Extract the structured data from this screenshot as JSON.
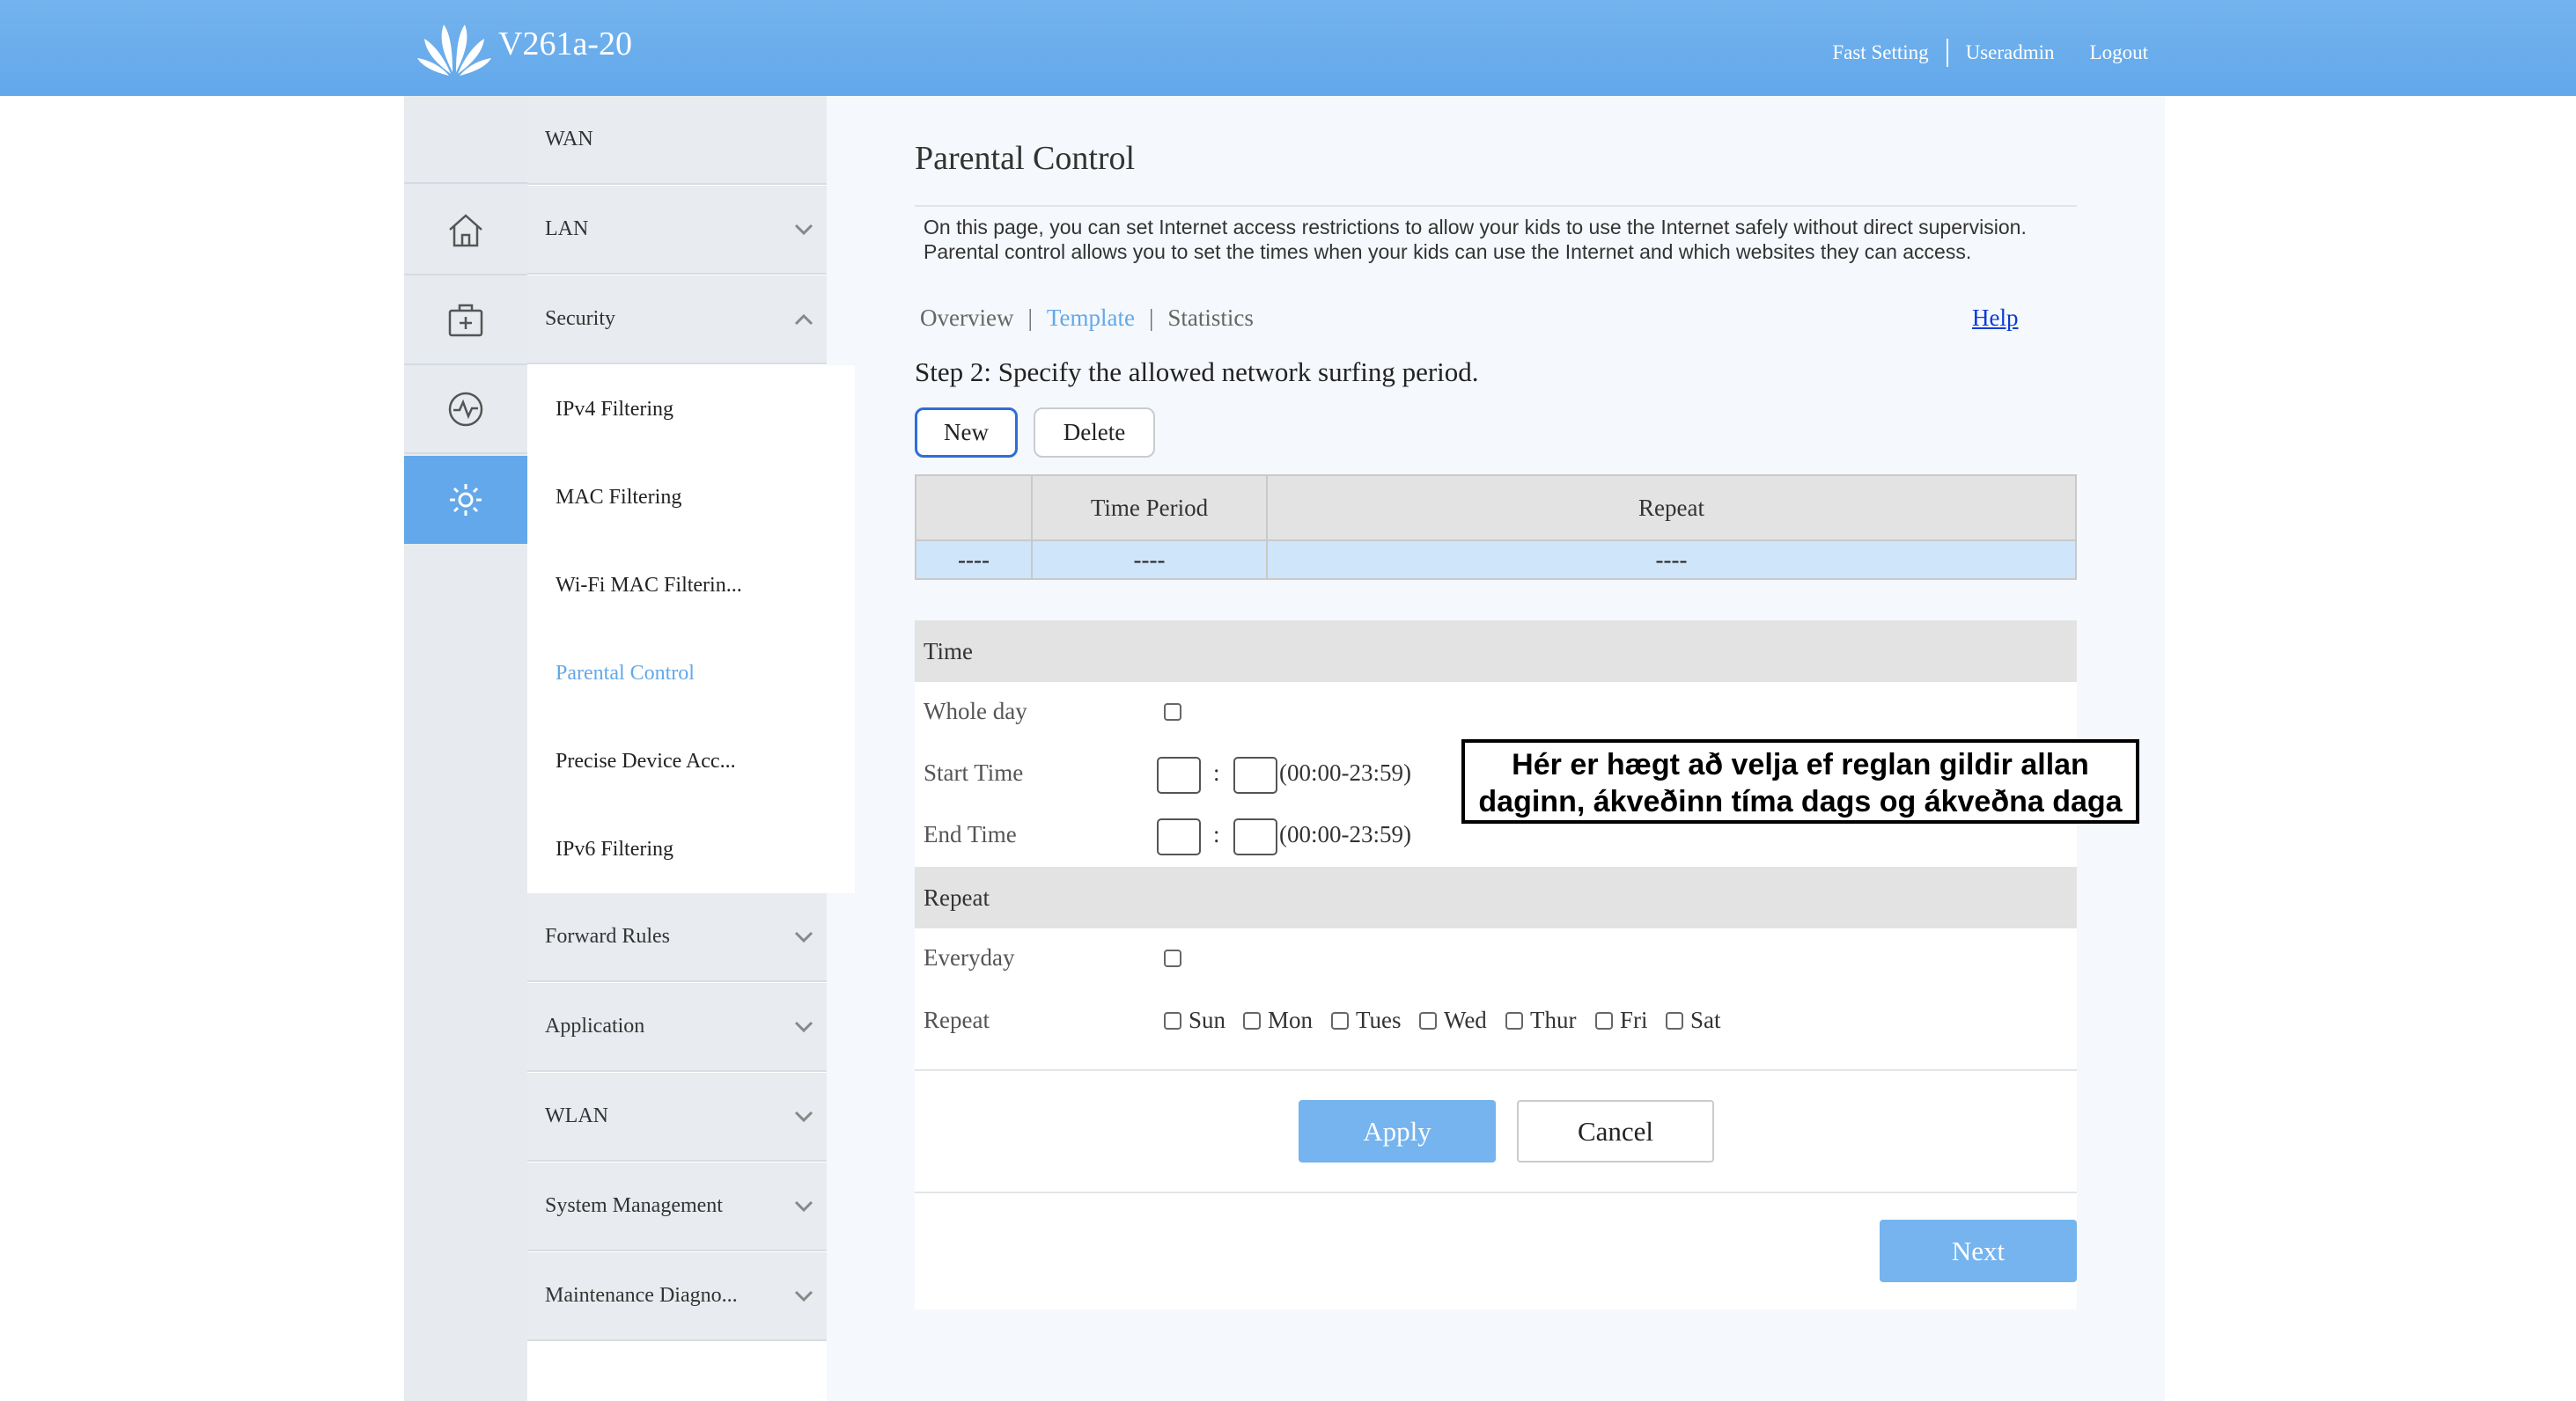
{
  "header": {
    "model": "V261a-20",
    "links": [
      "Fast Setting",
      "Useradmin",
      "Logout"
    ]
  },
  "icons": [
    "home-icon",
    "first-aid-icon",
    "diagnostics-icon",
    "settings-icon"
  ],
  "menu": {
    "wan": "WAN",
    "lan": "LAN",
    "security": "Security",
    "security_sub": [
      "IPv4 Filtering",
      "MAC Filtering",
      "Wi-Fi MAC Filterin...",
      "Parental Control",
      "Precise Device Acc...",
      "IPv6 Filtering"
    ],
    "forward_rules": "Forward Rules",
    "application": "Application",
    "wlan": "WLAN",
    "system_management": "System Management",
    "maintenance": "Maintenance Diagno..."
  },
  "main": {
    "title": "Parental Control",
    "intro_line1": "On this page, you can set Internet access restrictions to allow your kids to use the Internet safely without direct supervision.",
    "intro_line2": "Parental control allows you to set the times when your kids can use the Internet and which websites they can access.",
    "tabs": [
      "Overview",
      "Template",
      "Statistics"
    ],
    "tab_sep": "|",
    "help": "Help",
    "step": "Step 2: Specify the allowed network surfing period.",
    "buttons": {
      "new": "New",
      "delete": "Delete"
    },
    "table": {
      "headers": [
        "",
        "Time Period",
        "Repeat"
      ],
      "row": [
        "----",
        "----",
        "----"
      ]
    },
    "form": {
      "time_header": "Time",
      "whole_day": "Whole day",
      "start_time": "Start Time",
      "end_time": "End Time",
      "colon": ":",
      "range": "(00:00-23:59)",
      "repeat_header": "Repeat",
      "everyday": "Everyday",
      "repeat": "Repeat",
      "days": [
        "Sun",
        "Mon",
        "Tues",
        "Wed",
        "Thur",
        "Fri",
        "Sat"
      ]
    },
    "actions": {
      "apply": "Apply",
      "cancel": "Cancel",
      "next": "Next"
    }
  },
  "annotation": {
    "line1": "Hér er hægt að velja ef reglan gildir allan",
    "line2": "daginn, ákveðinn tíma dags og ákveðna daga"
  },
  "colors": {
    "accent": "#62a8ea",
    "header": "#6aaeec",
    "selected_row": "#cfe5fa"
  }
}
